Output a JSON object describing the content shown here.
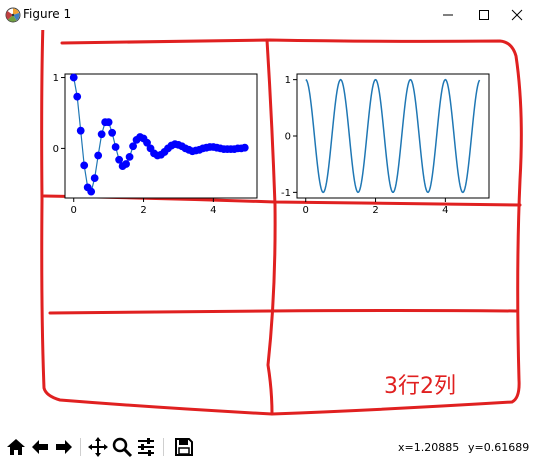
{
  "window": {
    "title": "Figure 1",
    "minimize_icon": "minimize-icon",
    "maximize_icon": "maximize-icon",
    "close_icon": "close-icon"
  },
  "annotation": {
    "text": "3行2列",
    "color": "#e02020"
  },
  "chart_data": [
    {
      "type": "line",
      "title": "",
      "xlabel": "",
      "ylabel": "",
      "xlim": [
        -0.25,
        5.25
      ],
      "ylim": [
        -0.7,
        1.05
      ],
      "xticks": [
        "0",
        "2",
        "4"
      ],
      "yticks": [
        "0",
        "1"
      ],
      "markers": "circle",
      "color": "#1f77b4",
      "marker_color": "#0000ff",
      "series": [
        {
          "x": [
            0,
            0.1,
            0.2,
            0.3,
            0.4,
            0.5,
            0.6,
            0.7,
            0.8,
            0.9,
            1.0,
            1.1,
            1.2,
            1.3,
            1.4,
            1.5,
            1.6,
            1.7,
            1.8,
            1.9,
            2.0,
            2.1,
            2.2,
            2.3,
            2.4,
            2.5,
            2.6,
            2.7,
            2.8,
            2.9,
            3.0,
            3.1,
            3.2,
            3.3,
            3.4,
            3.5,
            3.6,
            3.7,
            3.8,
            3.9,
            4.0,
            4.1,
            4.2,
            4.3,
            4.4,
            4.5,
            4.6,
            4.7,
            4.8,
            4.9
          ],
          "y": [
            1.0,
            0.73,
            0.25,
            -0.24,
            -0.55,
            -0.61,
            -0.42,
            -0.1,
            0.2,
            0.37,
            0.37,
            0.22,
            0.02,
            -0.16,
            -0.25,
            -0.22,
            -0.12,
            0.03,
            0.12,
            0.16,
            0.14,
            0.08,
            0.0,
            -0.07,
            -0.1,
            -0.09,
            -0.05,
            0.0,
            0.04,
            0.06,
            0.05,
            0.03,
            0.0,
            -0.02,
            -0.04,
            -0.03,
            -0.02,
            0.0,
            0.01,
            0.02,
            0.02,
            0.01,
            0.0,
            -0.01,
            -0.01,
            -0.01,
            -0.01,
            0.0,
            0.0,
            0.01
          ]
        }
      ]
    },
    {
      "type": "line",
      "title": "",
      "xlabel": "",
      "ylabel": "",
      "xlim": [
        -0.25,
        5.25
      ],
      "ylim": [
        -1.1,
        1.1
      ],
      "xticks": [
        "0",
        "2",
        "4"
      ],
      "yticks": [
        "-1",
        "0",
        "1"
      ],
      "color": "#1f77b4",
      "series": [
        {
          "function": "cos(2*pi*x)",
          "x_range": [
            0,
            4.98
          ],
          "samples": 250
        }
      ]
    }
  ],
  "toolbar": {
    "buttons": [
      {
        "icon": "home-icon"
      },
      {
        "icon": "back-arrow-icon"
      },
      {
        "icon": "forward-arrow-icon"
      },
      {
        "icon": "pan-icon"
      },
      {
        "icon": "zoom-icon"
      },
      {
        "icon": "configure-subplots-icon"
      },
      {
        "icon": "save-icon"
      }
    ],
    "x_coord": "x=1.20885",
    "y_coord": "y=0.61689"
  }
}
